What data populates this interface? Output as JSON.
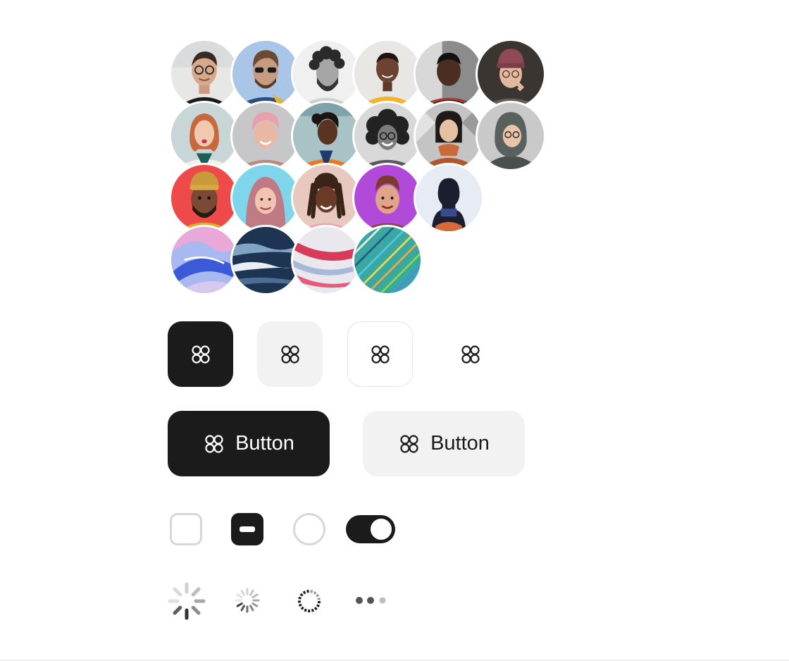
{
  "avatars": {
    "photos_row1": [
      "avatar-man-glasses",
      "avatar-man-sunglasses",
      "avatar-man-curly-bw",
      "avatar-man-yellow-shirt",
      "avatar-man-dark-bg",
      "avatar-man-beanie"
    ],
    "photos_row2": [
      "avatar-woman-red-hair",
      "avatar-woman-pink-hair",
      "avatar-woman-orange-jacket",
      "avatar-woman-curly-bw",
      "avatar-woman-scarf",
      "avatar-woman-hijab"
    ],
    "illustrations": [
      "avatar-3d-turban-man",
      "avatar-3d-hijab-woman",
      "avatar-3d-locs-woman",
      "avatar-3d-man-purple",
      "avatar-silhouette"
    ],
    "abstract": [
      "avatar-abstract-blue",
      "avatar-abstract-ocean",
      "avatar-abstract-pink",
      "avatar-abstract-threads"
    ]
  },
  "icon_buttons": {
    "icon": "command-icon",
    "variants": [
      "dark",
      "soft",
      "outline",
      "ghost"
    ]
  },
  "buttons": {
    "primary_label": "Button",
    "secondary_label": "Button"
  },
  "controls": {
    "checkbox": "unchecked",
    "checkbox_indeterminate": "indeterminate",
    "radio": "unselected",
    "toggle": "on"
  },
  "loaders": [
    "spinner-large",
    "spinner-small",
    "spinner-ring",
    "dots-loader"
  ],
  "colors": {
    "primary": "#1b1b1b",
    "soft": "#f2f2f2",
    "border": "#d7d7d7",
    "background": "#ffffff"
  }
}
